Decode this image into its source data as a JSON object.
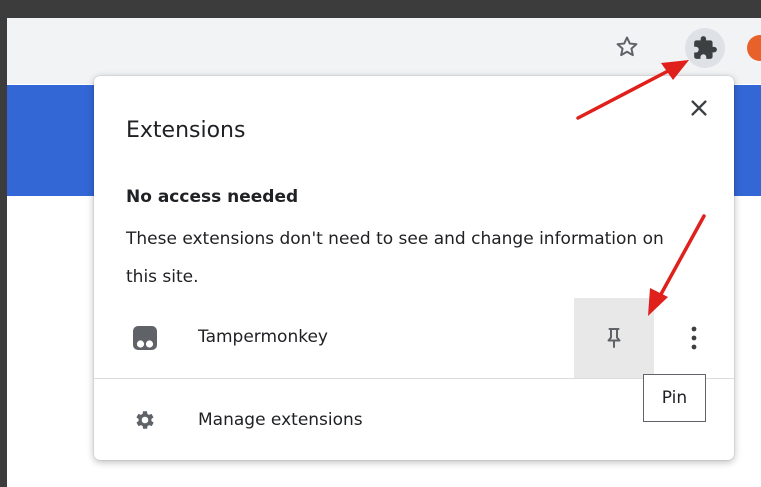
{
  "toolbar": {
    "bookmark_icon": "star-icon",
    "extensions_icon": "puzzle-piece-icon",
    "profile_color": "#e8612a"
  },
  "popup": {
    "title": "Extensions",
    "close_icon": "close-icon",
    "section_heading": "No access needed",
    "section_description": "These extensions don't need to see and change information on this site.",
    "extensions": [
      {
        "name": "Tampermonkey",
        "icon": "tampermonkey-icon",
        "pin_icon": "pin-icon",
        "menu_icon": "more-vert-icon"
      }
    ],
    "manage_label": "Manage extensions",
    "manage_icon": "gear-icon"
  },
  "tooltip": {
    "text": "Pin"
  },
  "colors": {
    "accent_band": "#3367d6",
    "annotation_arrow": "#e0201b",
    "toolbar_bg": "#f1f3f4",
    "pin_hover_bg": "#e8e8e8"
  }
}
